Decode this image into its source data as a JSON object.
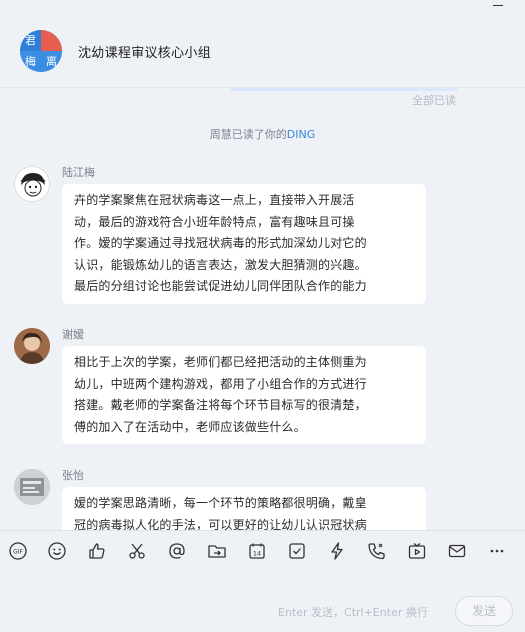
{
  "header": {
    "group_title": "沈幼课程审议核心小组",
    "avatar_chars": [
      "君",
      "梅",
      "离"
    ]
  },
  "chat": {
    "all_read": "全部已读",
    "system_message": {
      "prefix": "周慧已读了你的",
      "link": "DING"
    },
    "messages": [
      {
        "sender": "陆江梅",
        "lines": [
          "卉的学案聚焦在冠状病毒这一点上，直接带入开展活",
          "动，最后的游戏符合小班年龄特点，富有趣味且可操",
          "作。嫒的学案通过寻找冠状病毒的形式加深幼儿对它的",
          "认识，能锻炼幼儿的语言表达，激发大胆猜测的兴趣。",
          "最后的分组讨论也能尝试促进幼儿同伴团队合作的能力"
        ]
      },
      {
        "sender": "谢嫒",
        "lines": [
          "相比于上次的学案，老师们都已经把活动的主体侧重为",
          "幼儿，中班两个建构游戏，都用了小组合作的方式进行",
          "搭建。戴老师的学案备注将每个环节目标写的很清楚，",
          "傅的加入了在活动中，老师应该做些什么。"
        ]
      },
      {
        "sender": "张怡",
        "lines": [
          "嫒的学案思路清晰，每一个环节的策略都很明确，戴皇",
          "冠的病毒拟人化的手法，可以更好的让幼儿认识冠状病"
        ]
      }
    ]
  },
  "toolbar": {
    "icons": [
      "gif-icon",
      "emoji-icon",
      "thumbs-up-icon",
      "scissors-icon",
      "at-icon",
      "folder-share-icon",
      "calendar-icon",
      "task-check-icon",
      "ding-icon",
      "call-icon",
      "live-icon",
      "mail-icon",
      "more-icon"
    ],
    "gif_label": "GIF"
  },
  "input": {
    "hint": "Enter 发送，Ctrl+Enter 换行",
    "send_label": "发送"
  },
  "colors": {
    "accent": "#3a86d8",
    "background": "#eef1f5",
    "bubble": "#ffffff"
  }
}
